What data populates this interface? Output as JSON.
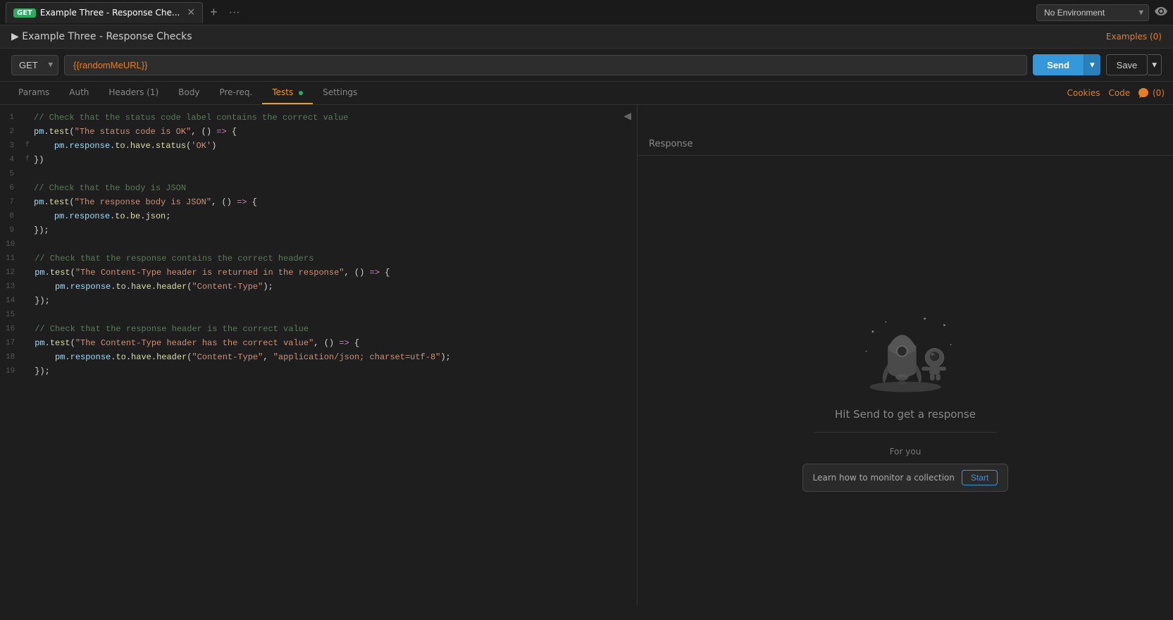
{
  "topbar": {
    "tab_label": "Example Three - Response Che...",
    "tab_get_badge": "GET",
    "add_tab_label": "+",
    "more_tabs_label": "···",
    "env_select_value": "No Environment",
    "env_options": [
      "No Environment"
    ]
  },
  "request_title": "Example Three - Response Checks",
  "examples_link": "Examples (0)",
  "url_bar": {
    "method": "GET",
    "url_value": "{{randomMeURL}}",
    "send_label": "Send",
    "save_label": "Save"
  },
  "tabs": {
    "items": [
      {
        "id": "params",
        "label": "Params",
        "active": false
      },
      {
        "id": "auth",
        "label": "Auth",
        "active": false
      },
      {
        "id": "headers",
        "label": "Headers (1)",
        "active": false
      },
      {
        "id": "body",
        "label": "Body",
        "active": false
      },
      {
        "id": "prereq",
        "label": "Pre-req.",
        "active": false
      },
      {
        "id": "tests",
        "label": "Tests",
        "active": true,
        "dot": true
      },
      {
        "id": "settings",
        "label": "Settings",
        "active": false
      }
    ],
    "right_items": [
      {
        "id": "cookies",
        "label": "Cookies"
      },
      {
        "id": "code",
        "label": "Code"
      },
      {
        "id": "comments",
        "label": "(0)"
      }
    ]
  },
  "code": {
    "lines": [
      {
        "num": 1,
        "content": "// Check that the status code label contains the correct value",
        "type": "comment"
      },
      {
        "num": 2,
        "content": "pm.test(\"The status code is OK\", () => {",
        "type": "code"
      },
      {
        "num": 3,
        "content": "    pm.response.to.have.status('OK')",
        "type": "code",
        "fold": true
      },
      {
        "num": 4,
        "content": "})",
        "type": "code",
        "fold": true
      },
      {
        "num": 5,
        "content": "",
        "type": "empty"
      },
      {
        "num": 6,
        "content": "// Check that the body is JSON",
        "type": "comment"
      },
      {
        "num": 7,
        "content": "pm.test(\"The response body is JSON\", () => {",
        "type": "code"
      },
      {
        "num": 8,
        "content": "    pm.response.to.be.json;",
        "type": "code"
      },
      {
        "num": 9,
        "content": "});",
        "type": "code"
      },
      {
        "num": 10,
        "content": "",
        "type": "empty"
      },
      {
        "num": 11,
        "content": "// Check that the response contains the correct headers",
        "type": "comment"
      },
      {
        "num": 12,
        "content": "pm.test(\"The Content-Type header is returned in the response\", () => {",
        "type": "code"
      },
      {
        "num": 13,
        "content": "    pm.response.to.have.header(\"Content-Type\");",
        "type": "code"
      },
      {
        "num": 14,
        "content": "});",
        "type": "code"
      },
      {
        "num": 15,
        "content": "",
        "type": "empty"
      },
      {
        "num": 16,
        "content": "// Check that the response header is the correct value",
        "type": "comment"
      },
      {
        "num": 17,
        "content": "pm.test(\"The Content-Type header has the correct value\", () => {",
        "type": "code"
      },
      {
        "num": 18,
        "content": "    pm.response.to.have.header(\"Content-Type\", \"application/json; charset=utf-8\");",
        "type": "code"
      },
      {
        "num": 19,
        "content": "});",
        "type": "code"
      }
    ]
  },
  "response_panel": {
    "header_label": "Response",
    "hit_send_text": "Hit Send to get a response",
    "for_you_label": "For you",
    "monitor_text": "Learn how to monitor a collection",
    "start_label": "Start"
  }
}
